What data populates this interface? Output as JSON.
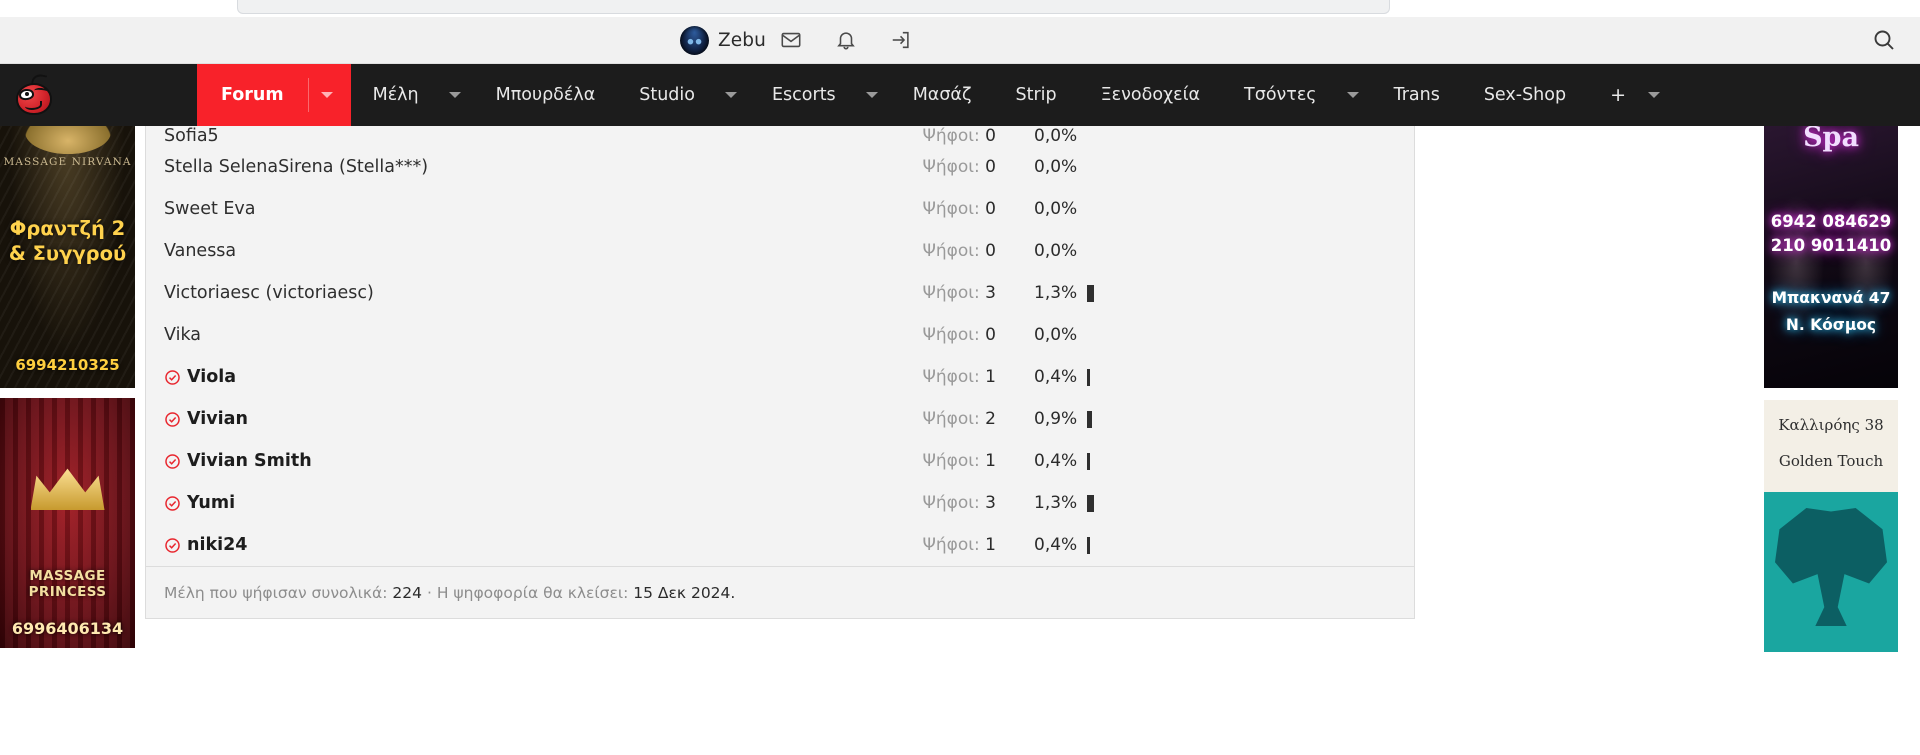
{
  "user_bar": {
    "username": "Zebu",
    "icons": [
      "envelope-icon",
      "bell-icon",
      "logout-icon",
      "search-icon"
    ]
  },
  "nav": {
    "logo": "cherry-mascot-logo",
    "items": [
      {
        "label": "Forum",
        "active": true,
        "caret": true
      },
      {
        "label": "Μέλη",
        "active": false,
        "caret": true
      },
      {
        "label": "Μπουρδέλα",
        "active": false,
        "caret": false
      },
      {
        "label": "Studio",
        "active": false,
        "caret": true
      },
      {
        "label": "Escorts",
        "active": false,
        "caret": true
      },
      {
        "label": "Μασάζ",
        "active": false,
        "caret": false
      },
      {
        "label": "Strip",
        "active": false,
        "caret": false
      },
      {
        "label": "Ξενοδοχεία",
        "active": false,
        "caret": false
      },
      {
        "label": "Τσόντες",
        "active": false,
        "caret": true
      },
      {
        "label": "Trans",
        "active": false,
        "caret": false
      },
      {
        "label": "Sex-Shop",
        "active": false,
        "caret": false
      }
    ],
    "more_label": "+",
    "more_caret": true
  },
  "poll": {
    "votes_label": "Ψήφοι:",
    "rows": [
      {
        "name": "Sofia5",
        "votes": "0",
        "pct": "0,0%",
        "bar": 0,
        "voted": false,
        "clipped": true
      },
      {
        "name": "Stella SelenaSirena (Stella***)",
        "votes": "0",
        "pct": "0,0%",
        "bar": 0,
        "voted": false
      },
      {
        "name": "Sweet Eva",
        "votes": "0",
        "pct": "0,0%",
        "bar": 0,
        "voted": false
      },
      {
        "name": "Vanessa",
        "votes": "0",
        "pct": "0,0%",
        "bar": 0,
        "voted": false
      },
      {
        "name": "Victoriaesc (victoriaesc)",
        "votes": "3",
        "pct": "1,3%",
        "bar": 7,
        "voted": false
      },
      {
        "name": "Vika",
        "votes": "0",
        "pct": "0,0%",
        "bar": 0,
        "voted": false
      },
      {
        "name": "Viola",
        "votes": "1",
        "pct": "0,4%",
        "bar": 3,
        "voted": true
      },
      {
        "name": "Vivian",
        "votes": "2",
        "pct": "0,9%",
        "bar": 5,
        "voted": true
      },
      {
        "name": "Vivian Smith",
        "votes": "1",
        "pct": "0,4%",
        "bar": 3,
        "voted": true
      },
      {
        "name": "Yumi",
        "votes": "3",
        "pct": "1,3%",
        "bar": 7,
        "voted": true
      },
      {
        "name": "niki24",
        "votes": "1",
        "pct": "0,4%",
        "bar": 3,
        "voted": true
      }
    ],
    "footer": {
      "total_label": "Μέλη που ψήφισαν συνολικά:",
      "total_value": "224",
      "separator": "·",
      "close_label": "Η ψηφοφορία θα κλείσει:",
      "close_value": "15 Δεκ 2024."
    }
  },
  "left_ads": [
    {
      "name": "massage-nirvana",
      "brand": "MASSAGE NIRVANA",
      "headline": "Φραντζή 2\n& Συγγρού",
      "headline_line1": "Φραντζή 2",
      "headline_line2": "& Συγγρού",
      "phone": "6994210325"
    },
    {
      "name": "massage-princess",
      "title": "MASSAGE PRINCESS",
      "phone": "6996406134"
    }
  ],
  "right_ads": [
    {
      "name": "spa-ad",
      "word": "Spa",
      "phone1": "6942 084629",
      "phone2": "210 9011410",
      "address1": "Μπακνανά 47",
      "address2": "Ν. Κόσμος"
    },
    {
      "name": "golden-touch-ad",
      "line1": "Καλλιρόης 38",
      "line2": "Golden Touch"
    }
  ],
  "colors": {
    "accent_red": "#f8222a",
    "nav_dark": "#1c1c1c",
    "check_red": "#e8262e",
    "poll_bg": "#f3f3f3"
  }
}
